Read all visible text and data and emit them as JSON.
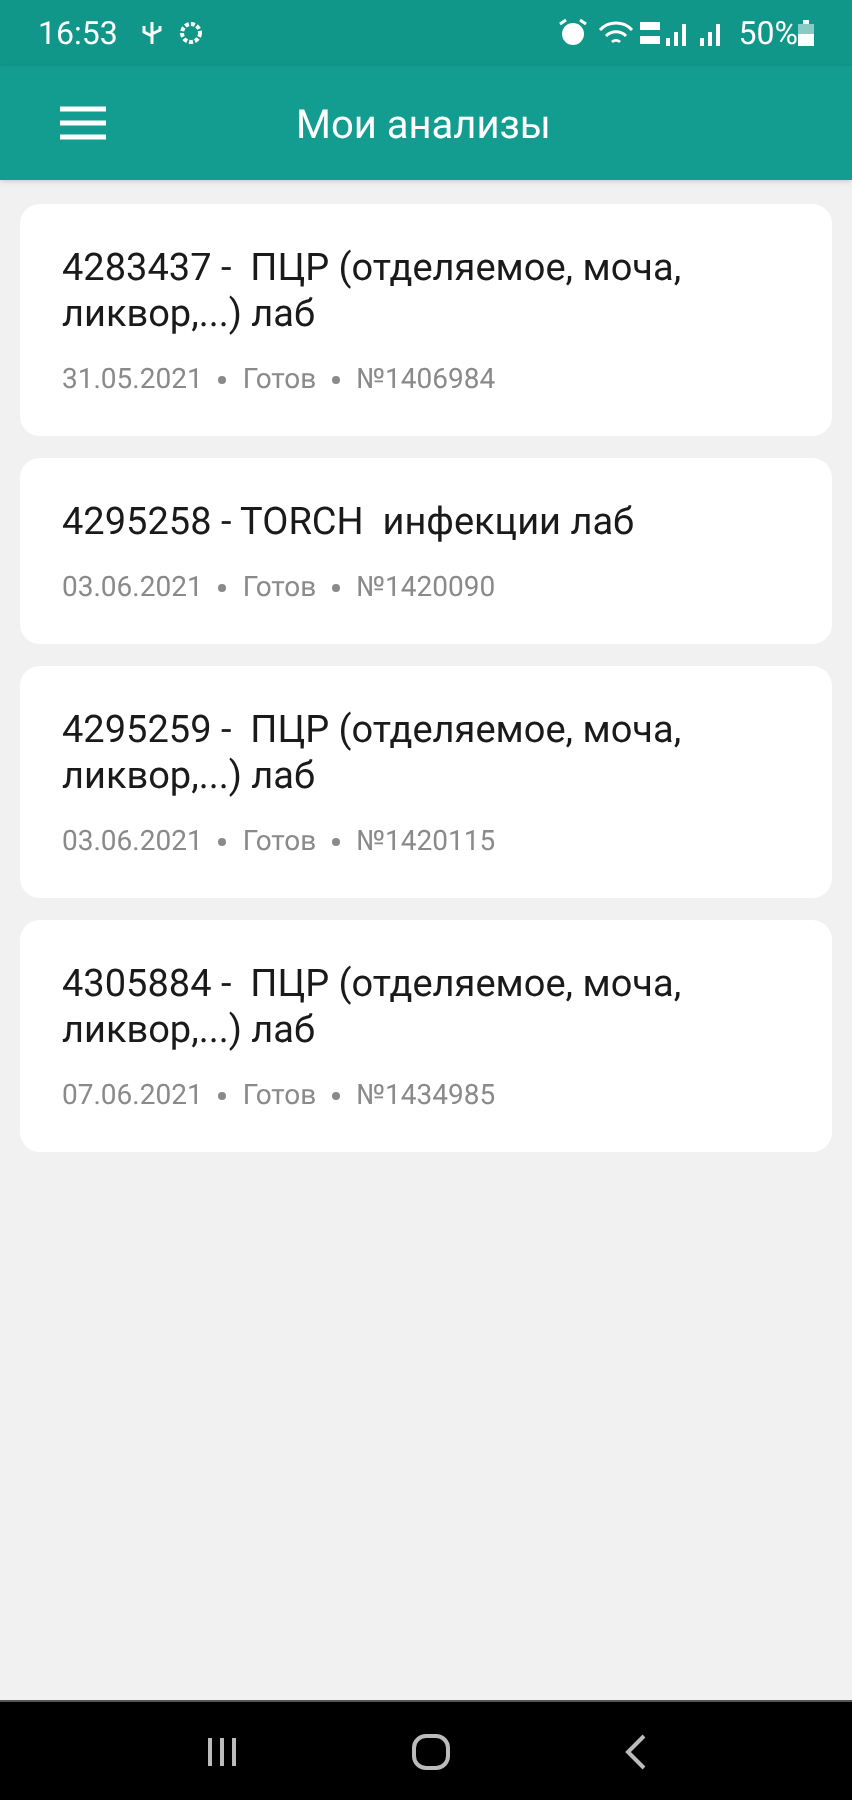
{
  "status_bar": {
    "time": "16:53",
    "battery": "50%"
  },
  "app_bar": {
    "title": "Мои анализы"
  },
  "analyses": [
    {
      "title": "4283437 -  ПЦР (отделяемое, моча, ликвор,...) лаб",
      "date": "31.05.2021",
      "status": "Готов",
      "number": "№1406984"
    },
    {
      "title": "4295258 - TORCH  инфекции лаб",
      "date": "03.06.2021",
      "status": "Готов",
      "number": "№1420090"
    },
    {
      "title": "4295259 -  ПЦР (отделяемое, моча, ликвор,...) лаб",
      "date": "03.06.2021",
      "status": "Готов",
      "number": "№1420115"
    },
    {
      "title": "4305884 -  ПЦР (отделяемое, моча, ликвор,...) лаб",
      "date": "07.06.2021",
      "status": "Готов",
      "number": "№1434985"
    }
  ]
}
